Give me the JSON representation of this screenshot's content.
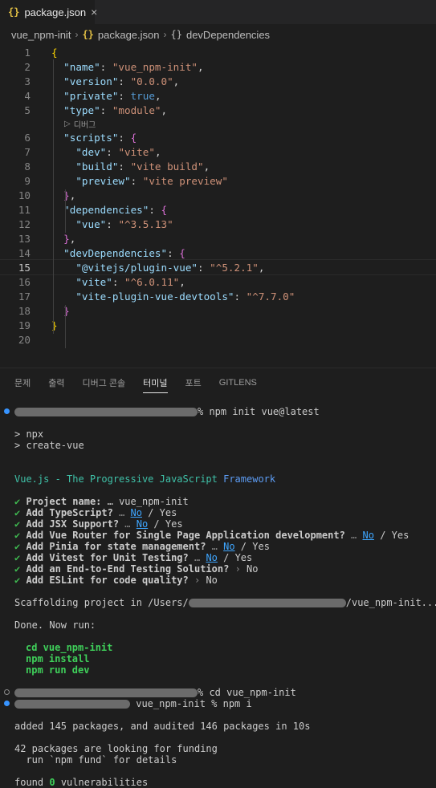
{
  "tab": {
    "icon": "{}",
    "label": "package.json",
    "close": "×"
  },
  "breadcrumb": {
    "folder": "vue_npm-init",
    "file_icon": "{}",
    "file": "package.json",
    "node_icon": "{}",
    "node": "devDependencies"
  },
  "editor": {
    "codelens": "디버그",
    "lines": {
      "1": "{",
      "2_key": "\"name\"",
      "2_val": "\"vue_npm-init\"",
      "3_key": "\"version\"",
      "3_val": "\"0.0.0\"",
      "4_key": "\"private\"",
      "4_val": "true",
      "5_key": "\"type\"",
      "5_val": "\"module\"",
      "6_key": "\"scripts\"",
      "7_key": "\"dev\"",
      "7_val": "\"vite\"",
      "8_key": "\"build\"",
      "8_val": "\"vite build\"",
      "9_key": "\"preview\"",
      "9_val": "\"vite preview\"",
      "11_key": "\"dependencies\"",
      "12_key": "\"vue\"",
      "12_val": "\"^3.5.13\"",
      "14_key": "\"devDependencies\"",
      "15_key": "\"@vitejs/plugin-vue\"",
      "15_val": "\"^5.2.1\"",
      "16_key": "\"vite\"",
      "16_val": "\"^6.0.11\"",
      "17_key": "\"vite-plugin-vue-devtools\"",
      "17_val": "\"^7.7.0\""
    }
  },
  "panel": {
    "tabs": [
      "문제",
      "출력",
      "디버그 콘솔",
      "터미널",
      "포트",
      "GITLENS"
    ],
    "active_tab": "터미널"
  },
  "terminal": {
    "cmd1": "% npm init vue@latest",
    "npx": "> npx",
    "create": "> create-vue",
    "banner_a": "Vue.js - The Progressive JavaScript ",
    "banner_b": "Framework",
    "check": "✔",
    "q1": "Project name:",
    "a1": " … vue_npm-init",
    "q2": "Add TypeScript?",
    "q3": "Add JSX Support?",
    "q4": "Add Vue Router for Single Page Application development?",
    "q5": "Add Pinia for state management?",
    "q6": "Add Vitest for Unit Testing?",
    "q7": "Add an End-to-End Testing Solution?",
    "q8": "Add ESLint for code quality?",
    "ellipsis": " … ",
    "arrow": " › ",
    "no": "No",
    "yes_sep": " / Yes",
    "scaffold_a": "Scaffolding project in /Users/",
    "scaffold_b": "/vue_npm-init...",
    "done": "Done. Now run:",
    "run1": "cd vue_npm-init",
    "run2": "npm install",
    "run3": "npm run dev",
    "cmd2": "% cd vue_npm-init",
    "cmd3": " vue_npm-init % npm i",
    "added": "added 145 packages, and audited 146 packages in 10s",
    "funding1": "42 packages are looking for funding",
    "funding2": "  run `npm fund` for details",
    "found_a": "found ",
    "found_num": "0",
    "found_b": " vulnerabilities"
  },
  "colors": {
    "background": "#1e1e1e",
    "string": "#ce9178",
    "key": "#9cdcfe",
    "success": "#3fb950",
    "link": "#3ea6ff"
  }
}
